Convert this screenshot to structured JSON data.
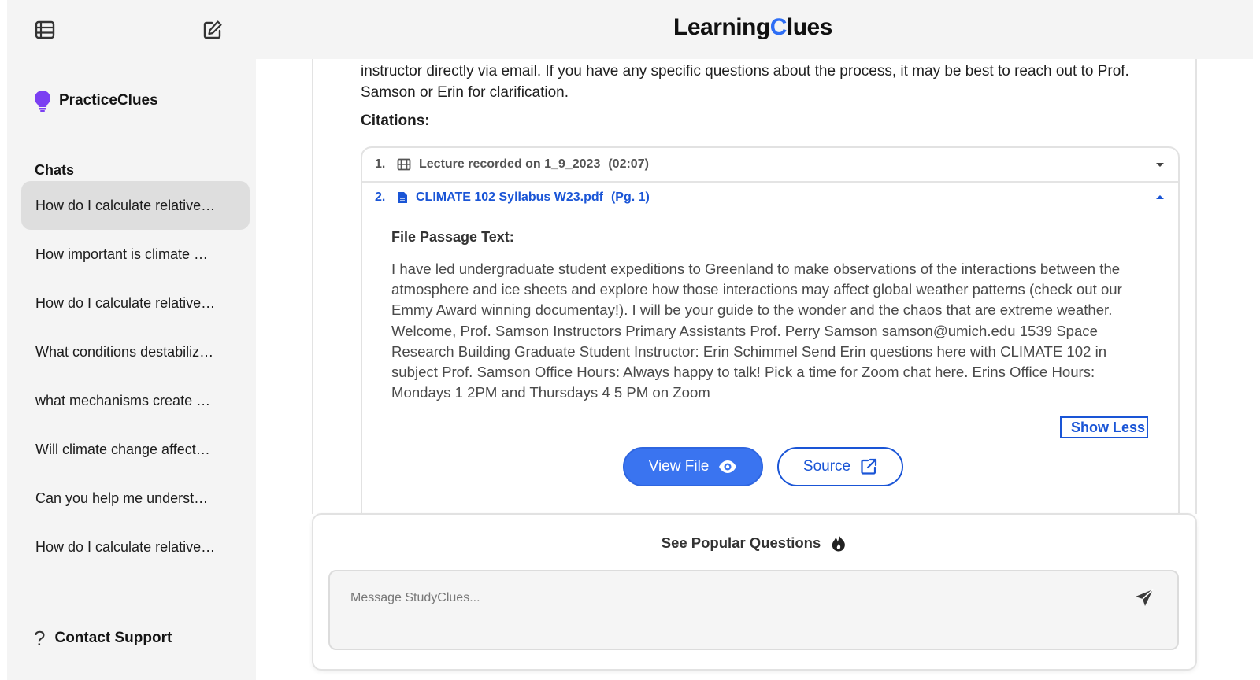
{
  "app": {
    "logo_prefix": "Learning",
    "logo_c": "C",
    "logo_suffix": "lues",
    "accent_color": "#2e6ef5"
  },
  "sidebar": {
    "brand": "PracticeClues",
    "chats_heading": "Chats",
    "chats": [
      "How do I calculate relative…",
      "How important is climate …",
      "How do I calculate relative…",
      "What conditions destabiliz…",
      "what mechanisms create …",
      "Will climate change affect…",
      "Can you help me underst…",
      "How do I calculate relative…"
    ],
    "support_label": "Contact Support"
  },
  "answer": {
    "tail_text": "instructor directly via email. If you have any specific questions about the process, it may be best to reach out to Prof. Samson or Erin for clarification.",
    "citations_label": "Citations:"
  },
  "citations": [
    {
      "num": "1.",
      "title": "Lecture recorded on 1_9_2023",
      "meta": "(02:07)",
      "icon": "film-icon"
    },
    {
      "num": "2.",
      "title": "CLIMATE 102 Syllabus W23.pdf",
      "meta": "(Pg. 1)",
      "icon": "file-icon"
    }
  ],
  "passage": {
    "heading": "File Passage Text:",
    "text": "I have led undergraduate student expeditions to Greenland to make observations of the interactions between the atmosphere and ice sheets and explore how those interactions may affect global weather patterns (check out our Emmy Award winning documentay!). I will be your guide to the wonder and the chaos that are extreme weather. Welcome, Prof. Samson Instructors Primary Assistants Prof. Perry Samson samson@umich.edu 1539 Space Research Building Graduate Student Instructor: Erin Schimmel Send Erin questions here with CLIMATE 102 in subject Prof. Samson Office Hours: Always happy to talk! Pick a time for Zoom chat here. Erins Office Hours: Mondays 1 2PM and Thursdays 4 5 PM on Zoom",
    "show_less": "Show Less",
    "view_file": "View File",
    "source": "Source"
  },
  "composer": {
    "popular": "See Popular Questions",
    "placeholder": "Message StudyClues..."
  }
}
